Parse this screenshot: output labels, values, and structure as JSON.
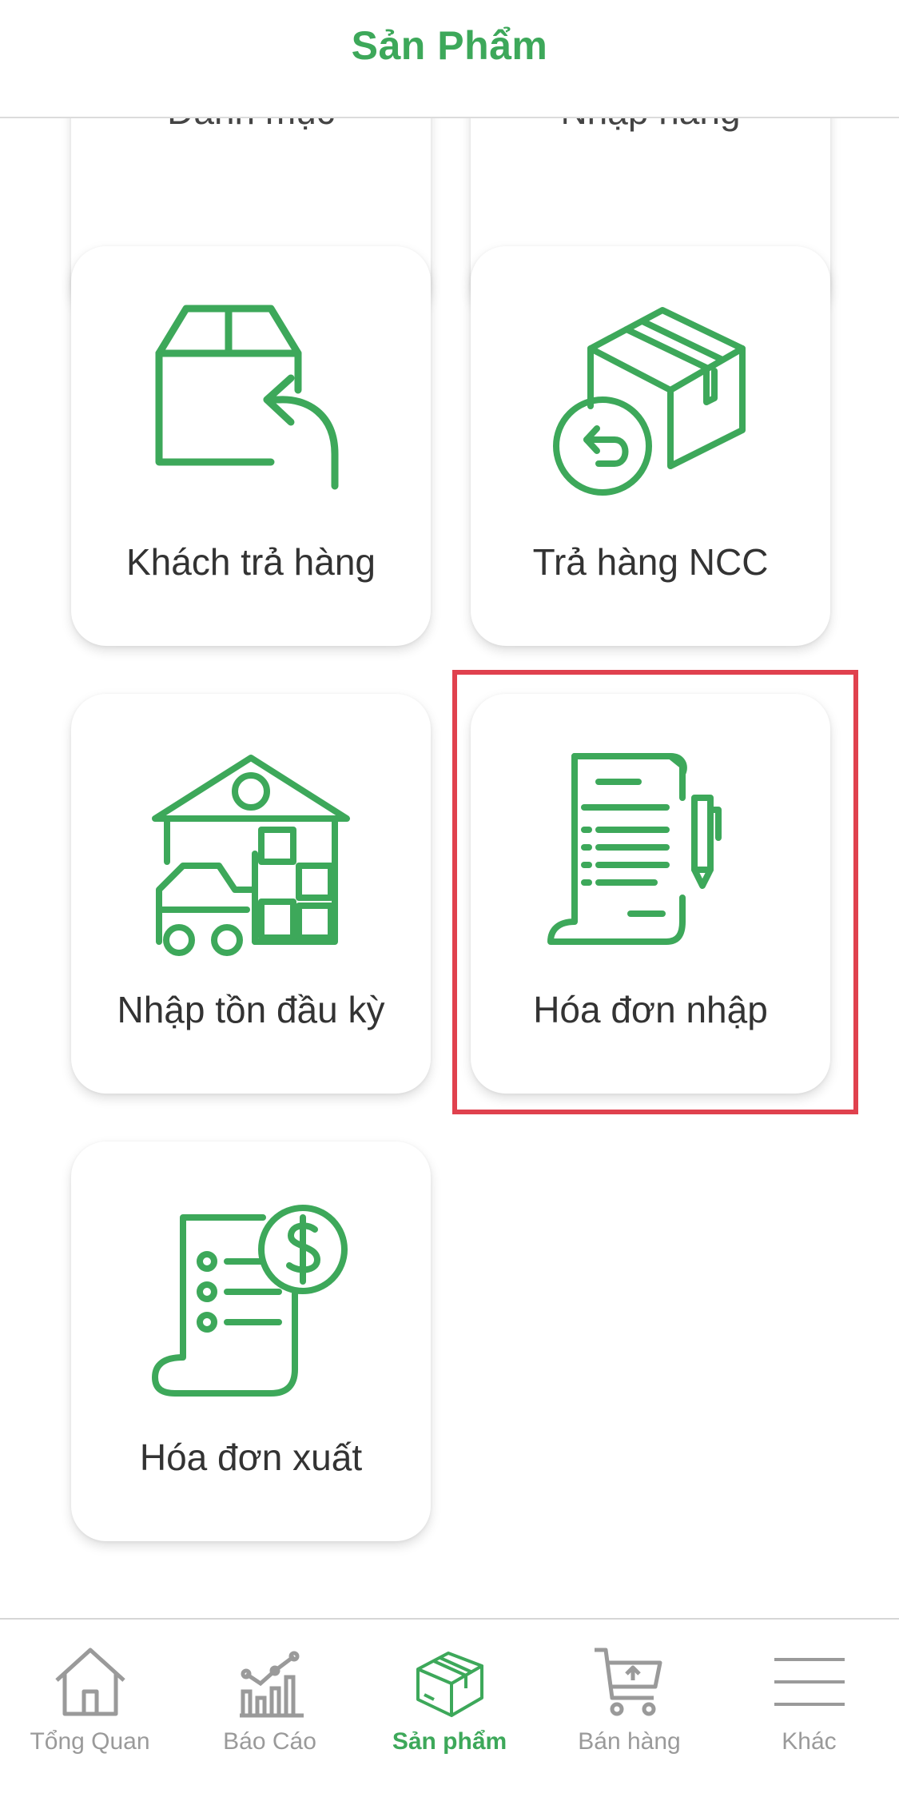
{
  "header": {
    "title": "Sản Phẩm"
  },
  "cards": [
    {
      "label": "Danh mục",
      "icon": "category-icon"
    },
    {
      "label": "Nhập hàng",
      "icon": "import-goods-icon"
    },
    {
      "label": "Khách trả hàng",
      "icon": "customer-return-box-icon"
    },
    {
      "label": "Trả hàng NCC",
      "icon": "supplier-return-box-icon"
    },
    {
      "label": "Nhập tồn đầu kỳ",
      "icon": "warehouse-forklift-icon"
    },
    {
      "label": "Hóa đơn nhập",
      "icon": "purchase-invoice-icon"
    },
    {
      "label": "Hóa đơn xuất",
      "icon": "sales-invoice-dollar-icon"
    }
  ],
  "tabs": [
    {
      "label": "Tổng Quan",
      "icon": "home-icon",
      "active": false
    },
    {
      "label": "Báo Cáo",
      "icon": "report-chart-icon",
      "active": false
    },
    {
      "label": "Sản phẩm",
      "icon": "product-box-icon",
      "active": true
    },
    {
      "label": "Bán hàng",
      "icon": "shopping-cart-icon",
      "active": false
    },
    {
      "label": "Khác",
      "icon": "menu-icon",
      "active": false
    }
  ],
  "colors": {
    "accent": "#3da85a",
    "highlight": "#e0414e",
    "inactive": "#9a9a9a",
    "text": "#333333"
  }
}
